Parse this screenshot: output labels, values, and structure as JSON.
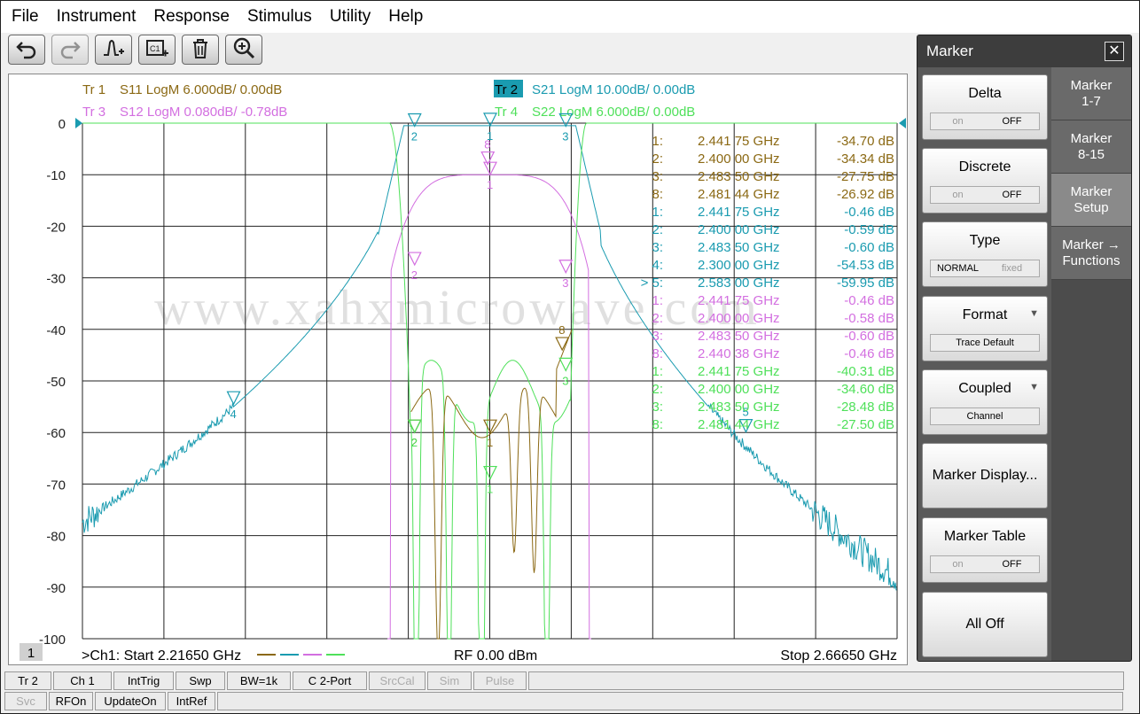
{
  "menu": [
    "File",
    "Instrument",
    "Response",
    "Stimulus",
    "Utility",
    "Help"
  ],
  "toolbar": [
    {
      "icon": "undo-icon",
      "enabled": true
    },
    {
      "icon": "redo-icon",
      "enabled": false
    },
    {
      "icon": "add-marker-icon",
      "enabled": true
    },
    {
      "icon": "add-channel-icon",
      "enabled": true
    },
    {
      "icon": "trash-icon",
      "enabled": true
    },
    {
      "icon": "zoom-in-icon",
      "enabled": true
    }
  ],
  "traces": [
    {
      "label": "Tr 1",
      "desc": "S11 LogM 6.000dB/  0.00dB",
      "color": "#8b6914"
    },
    {
      "label": "Tr 2",
      "desc": "S21 LogM 10.00dB/  0.00dB",
      "color": "#1a9bb0",
      "active": true
    },
    {
      "label": "Tr 3",
      "desc": "S12 LogM 0.080dB/  -0.78dB",
      "color": "#d36fe0"
    },
    {
      "label": "Tr 4",
      "desc": "S22 LogM 6.000dB/  0.00dB",
      "color": "#4fe05a"
    }
  ],
  "y_ticks": [
    "0",
    "-10",
    "-20",
    "-30",
    "-40",
    "-50",
    "-60",
    "-70",
    "-80",
    "-90",
    "-100"
  ],
  "watermark": "www.xahxmicrowave.com",
  "marker_table": [
    {
      "num": "1:",
      "freq": "2.441 75 GHz",
      "val": "-34.70 dB",
      "trace": 0
    },
    {
      "num": "2:",
      "freq": "2.400 00 GHz",
      "val": "-34.34 dB",
      "trace": 0
    },
    {
      "num": "3:",
      "freq": "2.483 50 GHz",
      "val": "-27.75 dB",
      "trace": 0
    },
    {
      "num": "8:",
      "freq": "2.481 44 GHz",
      "val": "-26.92 dB",
      "trace": 0
    },
    {
      "num": "1:",
      "freq": "2.441 75 GHz",
      "val": "-0.46 dB",
      "trace": 1
    },
    {
      "num": "2:",
      "freq": "2.400 00 GHz",
      "val": "-0.59 dB",
      "trace": 1
    },
    {
      "num": "3:",
      "freq": "2.483 50 GHz",
      "val": "-0.60 dB",
      "trace": 1
    },
    {
      "num": "4:",
      "freq": "2.300 00 GHz",
      "val": "-54.53 dB",
      "trace": 1
    },
    {
      "num": "> 5:",
      "freq": "2.583 00 GHz",
      "val": "-59.95 dB",
      "trace": 1
    },
    {
      "num": "1:",
      "freq": "2.441 75 GHz",
      "val": "-0.46 dB",
      "trace": 2
    },
    {
      "num": "2:",
      "freq": "2.400 00 GHz",
      "val": "-0.58 dB",
      "trace": 2
    },
    {
      "num": "3:",
      "freq": "2.483 50 GHz",
      "val": "-0.60 dB",
      "trace": 2
    },
    {
      "num": "8:",
      "freq": "2.440 38 GHz",
      "val": "-0.46 dB",
      "trace": 2
    },
    {
      "num": "1:",
      "freq": "2.441 75 GHz",
      "val": "-40.31 dB",
      "trace": 3
    },
    {
      "num": "2:",
      "freq": "2.400 00 GHz",
      "val": "-34.60 dB",
      "trace": 3
    },
    {
      "num": "3:",
      "freq": "2.483 50 GHz",
      "val": "-28.48 dB",
      "trace": 3
    },
    {
      "num": "8:",
      "freq": "2.481 44 GHz",
      "val": "-27.50 dB",
      "trace": 3
    }
  ],
  "channel": {
    "number": "1",
    "start_label": ">Ch1:  Start  2.21650 GHz",
    "rf_label": "RF    0.00 dBm",
    "stop_label": "Stop  2.66650 GHz"
  },
  "softkeys": {
    "title": "Marker",
    "close": "✕",
    "buttons": [
      {
        "label": "Delta",
        "kind": "toggle",
        "left": "on",
        "right": "OFF",
        "selected": "right"
      },
      {
        "label": "Discrete",
        "kind": "toggle",
        "left": "on",
        "right": "OFF",
        "selected": "right"
      },
      {
        "label": "Type",
        "kind": "toggle",
        "left": "NORMAL",
        "right": "fixed",
        "selected": "left"
      },
      {
        "label": "Format",
        "kind": "dropdown",
        "value": "Trace Default"
      },
      {
        "label": "Coupled",
        "kind": "dropdown",
        "value": "Channel"
      },
      {
        "label": "Marker Display...",
        "kind": "single"
      },
      {
        "label": "Marker Table",
        "kind": "toggle",
        "left": "on",
        "right": "OFF",
        "selected": "right"
      },
      {
        "label": "All Off",
        "kind": "single"
      }
    ],
    "tabs": [
      {
        "label": "Marker\n1-7"
      },
      {
        "label": "Marker\n8-15"
      },
      {
        "label": "Marker\nSetup",
        "active": true
      },
      {
        "label": "Marker →\nFunctions"
      }
    ]
  },
  "status_row1": [
    {
      "label": "Tr 2",
      "enabled": true
    },
    {
      "label": "Ch 1",
      "enabled": true
    },
    {
      "label": "IntTrig",
      "enabled": true
    },
    {
      "label": "Swp",
      "enabled": true
    },
    {
      "label": "BW=1k",
      "enabled": true
    },
    {
      "label": "C  2-Port",
      "enabled": true
    },
    {
      "label": "SrcCal",
      "enabled": false
    },
    {
      "label": "Sim",
      "enabled": false
    },
    {
      "label": "Pulse",
      "enabled": false
    }
  ],
  "status_row2": [
    {
      "label": "Svc",
      "enabled": false
    },
    {
      "label": "RFOn",
      "enabled": true
    },
    {
      "label": "UpdateOn",
      "enabled": true
    },
    {
      "label": "IntRef",
      "enabled": true
    }
  ]
}
